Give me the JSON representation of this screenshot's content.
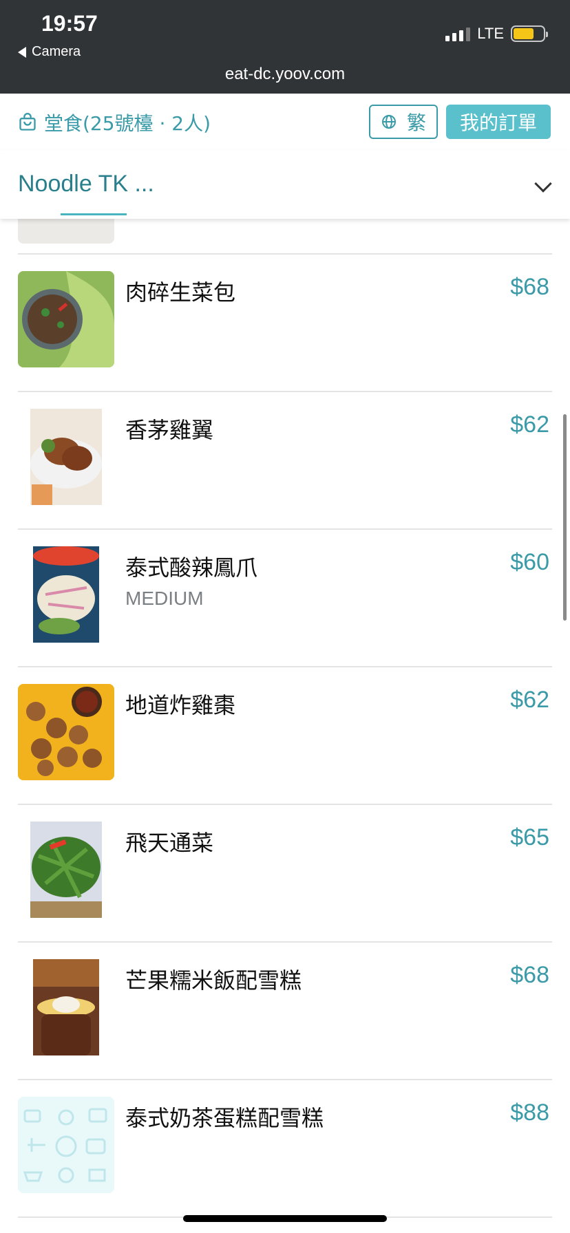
{
  "status_bar": {
    "time": "19:57",
    "back_label": "Camera",
    "network": "LTE",
    "url": "eat-dc.yoov.com",
    "battery_level": 0.7,
    "battery_color": "#f5c518",
    "signal_bars": 3
  },
  "header": {
    "dine_info": "堂食(25號檯 · 2人)",
    "language_label": "繁",
    "orders_label": "我的訂單"
  },
  "category": {
    "name": "Noodle TK ..."
  },
  "menu_items": [
    {
      "name": "肉碎生菜包",
      "subtitle": "",
      "price": "$68",
      "image": "minced-pork-lettuce-photo"
    },
    {
      "name": "香茅雞翼",
      "subtitle": "",
      "price": "$62",
      "image": "lemongrass-chicken-wings-photo"
    },
    {
      "name": "泰式酸辣鳳爪",
      "subtitle": "MEDIUM",
      "price": "$60",
      "image": "thai-chicken-feet-photo"
    },
    {
      "name": "地道炸雞棗",
      "subtitle": "",
      "price": "$62",
      "image": "fried-chicken-balls-photo"
    },
    {
      "name": "飛天通菜",
      "subtitle": "",
      "price": "$65",
      "image": "morning-glory-photo"
    },
    {
      "name": "芒果糯米飯配雪糕",
      "subtitle": "",
      "price": "$68",
      "image": "mango-sticky-rice-photo"
    },
    {
      "name": "泰式奶茶蛋糕配雪糕",
      "subtitle": "",
      "price": "$88",
      "image": "placeholder-image"
    }
  ],
  "colors": {
    "accent": "#3a9aa8",
    "accent_fill": "#5ac0cc",
    "status_bar_bg": "#303436"
  }
}
